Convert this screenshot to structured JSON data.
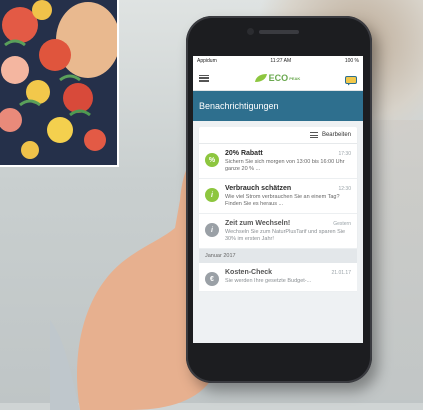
{
  "statusbar": {
    "carrier": "Appidum",
    "time": "11:27 AM",
    "battery": "100 %"
  },
  "logo": {
    "text": "ECO",
    "sub": "PEAK"
  },
  "colors": {
    "header": "#2e6f8e",
    "green": "#8dc63f",
    "gray": "#9aa0a6"
  },
  "header": {
    "title": "Benachrichtigungen"
  },
  "toolbar": {
    "edit_label": "Bearbeiten"
  },
  "notifications": [
    {
      "icon": "%",
      "title": "20% Rabatt",
      "time": "17:30",
      "desc": "Sichern Sie sich morgen von 13:00 bis 16:00 Uhr ganze 20 % ..."
    },
    {
      "icon": "i",
      "title": "Verbrauch schätzen",
      "time": "12:30",
      "desc": "Wie viel Strom verbrauchen Sie an einem Tag? Finden Sie es heraus ..."
    },
    {
      "icon": "i",
      "title": "Zeit zum Wechseln!",
      "time": "Gestern",
      "desc": "Wechseln Sie zum NaturPlusTarif und sparen Sie 30% im ersten Jahr!"
    }
  ],
  "section": {
    "label": "Januar 2017"
  },
  "older": [
    {
      "icon": "€",
      "title": "Kosten-Check",
      "time": "21.01.17",
      "desc": "Sie werden Ihre gesetzte Budget-..."
    }
  ]
}
